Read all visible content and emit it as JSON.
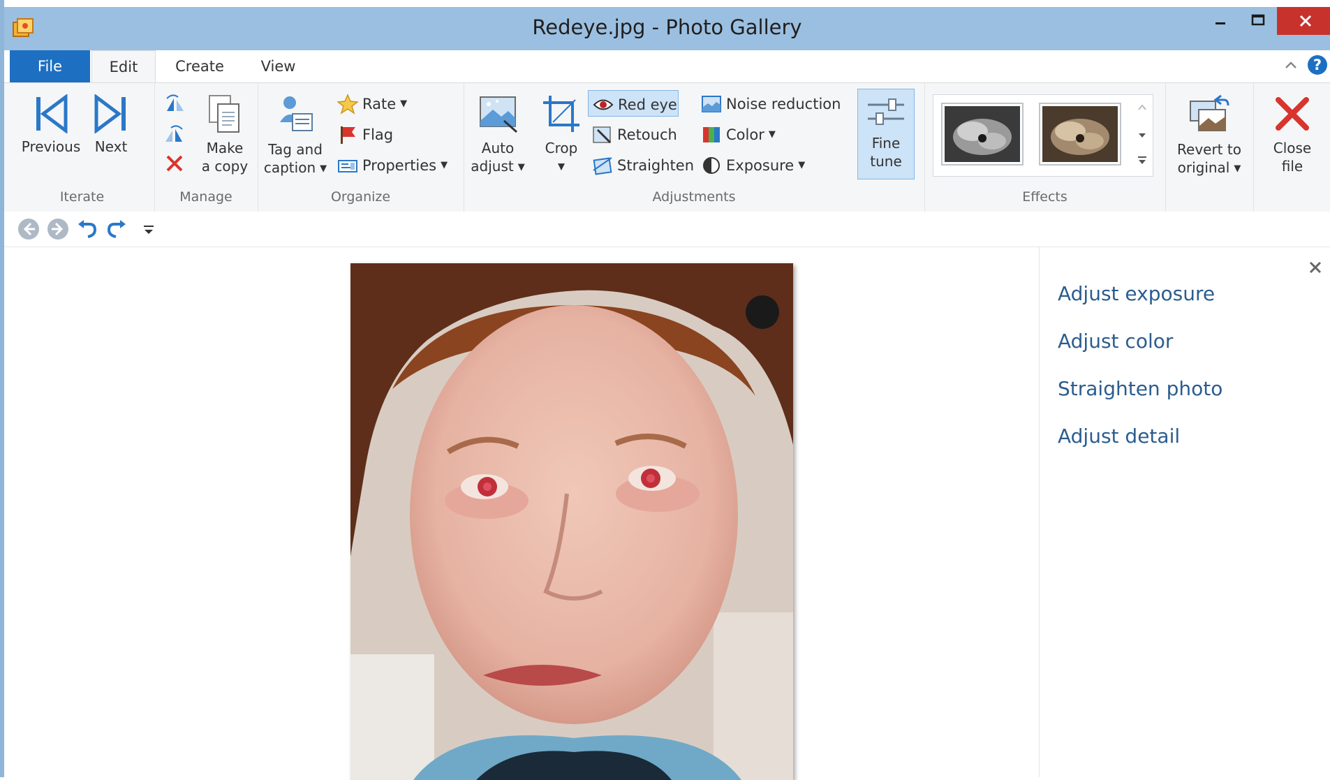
{
  "window": {
    "title": "Redeye.jpg - Photo Gallery",
    "accent_color": "#1d6fc2",
    "close_color": "#c8322d",
    "titlebar_color": "#9bbfe0"
  },
  "tabs": [
    {
      "label": "File"
    },
    {
      "label": "Edit"
    },
    {
      "label": "Create"
    },
    {
      "label": "View"
    }
  ],
  "ribbon": {
    "iterate": {
      "label": "Iterate",
      "previous": "Previous",
      "next": "Next"
    },
    "manage": {
      "label": "Manage",
      "make_copy_1": "Make",
      "make_copy_2": "a copy"
    },
    "organize": {
      "label": "Organize",
      "tag_1": "Tag and",
      "tag_2": "caption",
      "rate": "Rate",
      "flag": "Flag",
      "properties": "Properties"
    },
    "adjustments": {
      "label": "Adjustments",
      "auto_1": "Auto",
      "auto_2": "adjust",
      "crop": "Crop",
      "red_eye": "Red eye",
      "retouch": "Retouch",
      "straighten": "Straighten",
      "noise_reduction": "Noise reduction",
      "color": "Color",
      "exposure": "Exposure",
      "fine_1": "Fine",
      "fine_2": "tune"
    },
    "effects": {
      "label": "Effects"
    },
    "revert": {
      "revert_1": "Revert to",
      "revert_2": "original",
      "close_1": "Close",
      "close_2": "file"
    }
  },
  "fine_tune_pane": {
    "items": [
      {
        "label": "Adjust exposure"
      },
      {
        "label": "Adjust color"
      },
      {
        "label": "Straighten photo"
      },
      {
        "label": "Adjust detail"
      }
    ]
  },
  "icons": {
    "app": "photo-gallery-app-icon",
    "previous": "skip-back-icon",
    "next": "skip-forward-icon",
    "red_eye": "eye-icon",
    "close_file": "red-x-icon"
  }
}
